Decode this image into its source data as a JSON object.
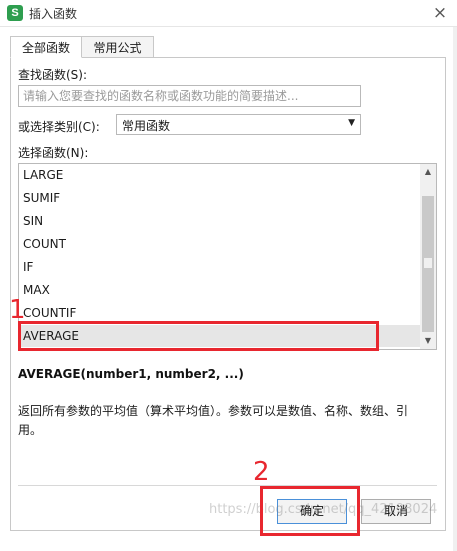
{
  "window": {
    "title": "插入函数",
    "icon_letter": "S",
    "close_glyph": "×"
  },
  "tabs": [
    {
      "label": "全部函数"
    },
    {
      "label": "常用公式"
    }
  ],
  "search": {
    "label": "查找函数(S):",
    "placeholder": "请输入您要查找的函数名称或函数功能的简要描述..."
  },
  "category": {
    "label": "或选择类别(C):",
    "value": "常用函数",
    "arrow_glyph": "▼"
  },
  "function_list": {
    "label": "选择函数(N):",
    "items": [
      "LARGE",
      "SUMIF",
      "SIN",
      "COUNT",
      "IF",
      "MAX",
      "COUNTIF",
      "AVERAGE"
    ],
    "selected": "AVERAGE"
  },
  "scroll": {
    "up_glyph": "▲",
    "down_glyph": "▼"
  },
  "selected_function": {
    "syntax": "AVERAGE(number1, number2, ...)",
    "description": "返回所有参数的平均值（算术平均值）。参数可以是数值、名称、数组、引用。"
  },
  "buttons": {
    "ok": "确定",
    "cancel": "取消"
  },
  "annotations": {
    "num1": "1",
    "num2": "2",
    "color": "#e8272f"
  },
  "watermark": "https://blog.csdn.net/qq_42198024",
  "colors": {
    "app_icon": "#2e9e4f",
    "selection": "#e6e6e6"
  }
}
